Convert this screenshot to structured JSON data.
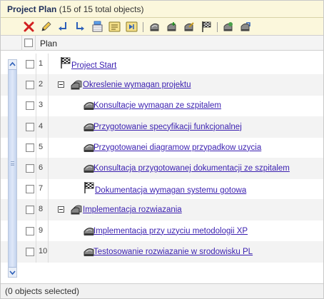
{
  "window": {
    "title": "Project Plan",
    "count_text": "(15 of 15 total objects)"
  },
  "toolbar": {
    "items": [
      {
        "name": "delete-icon"
      },
      {
        "name": "edit-pencil-icon"
      },
      {
        "name": "indent-icon"
      },
      {
        "name": "outdent-icon"
      },
      {
        "name": "insert-row-icon"
      },
      {
        "name": "list-view-icon"
      },
      {
        "name": "step-view-icon"
      },
      {
        "name": "task-icon"
      },
      {
        "name": "task-add-icon"
      },
      {
        "name": "task-edit-icon"
      },
      {
        "name": "milestone-flag-icon"
      },
      {
        "name": "open-task-icon"
      },
      {
        "name": "export-task-icon"
      }
    ]
  },
  "table": {
    "header": {
      "plan": "Plan"
    },
    "rows": [
      {
        "num": "1",
        "label": "Project Start",
        "icon": "milestone-flag-icon",
        "indent": 0,
        "expander": false
      },
      {
        "num": "2",
        "label": "Okreslenie wymagan projektu",
        "icon": "summary-task-icon",
        "indent": 0,
        "expander": true
      },
      {
        "num": "3",
        "label": "Konsultacje wymagan ze szpitalem",
        "icon": "task-icon",
        "indent": 1,
        "expander": false
      },
      {
        "num": "4",
        "label": "Przygotowanie specyfikacji funkcjonalnej",
        "icon": "task-icon",
        "indent": 1,
        "expander": false
      },
      {
        "num": "5",
        "label": "Przygotowanei diagramow przypadkow uzycia",
        "icon": "task-icon",
        "indent": 1,
        "expander": false
      },
      {
        "num": "6",
        "label": "Konsultacja przygotowanej dokumentacji ze szpitalem",
        "icon": "task-icon",
        "indent": 1,
        "expander": false
      },
      {
        "num": "7",
        "label": "Dokumentacja wymagan systemu gotowa",
        "icon": "milestone-flag-icon",
        "indent": 1,
        "expander": false
      },
      {
        "num": "8",
        "label": "Implementacja rozwiazania",
        "icon": "summary-task-icon",
        "indent": 0,
        "expander": true
      },
      {
        "num": "9",
        "label": "Implementacja przy uzyciu metodologii XP",
        "icon": "task-icon",
        "indent": 1,
        "expander": false
      },
      {
        "num": "10",
        "label": "Testosowanie rozwiazanie w srodowisku PL",
        "icon": "task-icon",
        "indent": 1,
        "expander": false
      }
    ]
  },
  "status": {
    "text": "(0 objects selected)"
  },
  "colors": {
    "title_bg": "#fbf7dc",
    "link": "#3a1fb0",
    "alt_row": "#f3f3f3",
    "delete_red": "#d22020"
  }
}
